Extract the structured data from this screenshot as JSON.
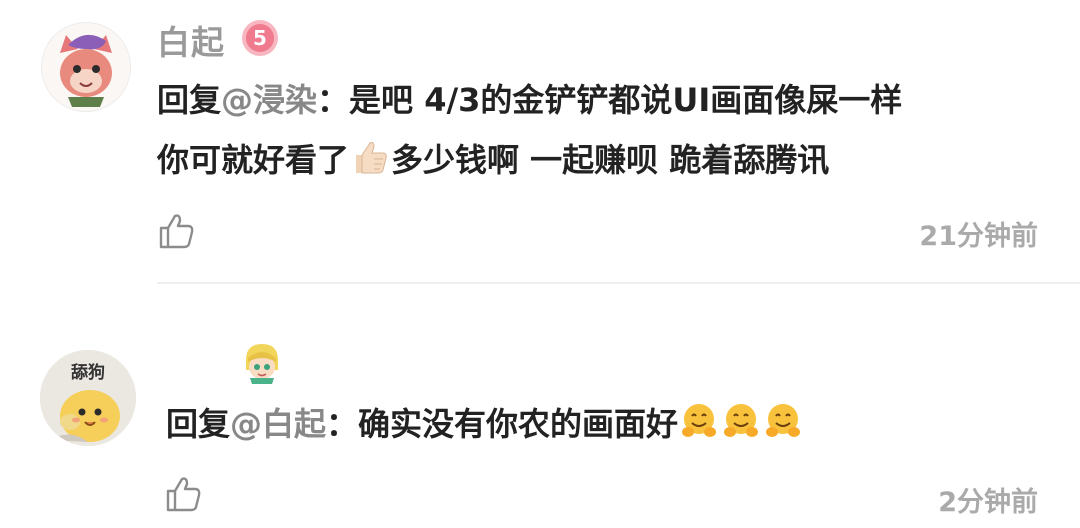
{
  "comments": [
    {
      "username": "白起",
      "level": "5",
      "reply_prefix": "回复",
      "mention": "@浸染",
      "separator": "：",
      "line1": "是吧 4/3的金铲铲都说UI画面像屎一样",
      "line2_a": "你可就好看了",
      "line2_b": "多少钱啊 一起赚呗 跪着舔腾讯",
      "emoji": "thumbs-up",
      "timestamp": "21分钟前",
      "avatar": "fox-cat-cartoon"
    },
    {
      "username": "",
      "avatar_caption": "舔狗",
      "reply_prefix": "回复",
      "mention": "@白起",
      "separator": "：",
      "text": "确实没有你农的画面好",
      "emojis": [
        "hugging-face",
        "hugging-face",
        "hugging-face"
      ],
      "timestamp": "2分钟前",
      "avatar": "yellow-chick-cartoon"
    }
  ],
  "colors": {
    "username": "#9a9a9a",
    "mention": "#888888",
    "text": "#222222",
    "timestamp": "#aaaaaa",
    "level_badge": "#f07a8e"
  }
}
